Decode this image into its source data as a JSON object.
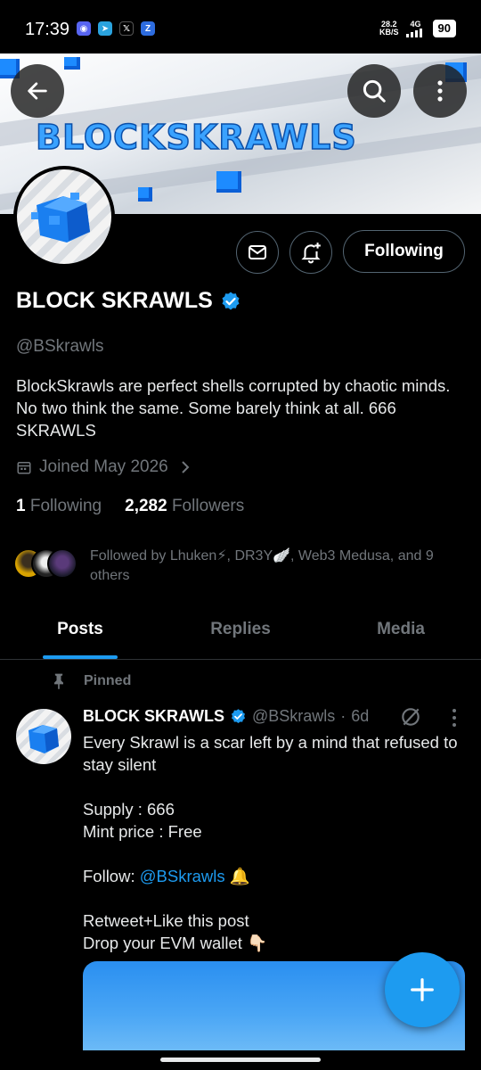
{
  "status_bar": {
    "time": "17:39",
    "net_speed_value": "28.2",
    "net_speed_unit": "KB/S",
    "network": "4G",
    "battery": "90"
  },
  "banner": {
    "title": "BLOCKSKRAWLS"
  },
  "profile": {
    "display_name": "BLOCK SKRAWLS",
    "handle": "@BSkrawls",
    "bio": "BlockSkrawls are perfect shells corrupted by chaotic minds. No two think the same. Some barely think at all. 666 SKRAWLS",
    "joined": "Joined May 2026",
    "following_count": "1",
    "following_label": "Following",
    "followers_count": "2,282",
    "followers_label": "Followers",
    "follow_button_label": "Following",
    "followed_by": "Followed by Lhuken⚡, DR3Y🪽, Web3 Medusa, and 9 others"
  },
  "tabs": [
    {
      "label": "Posts",
      "active": true
    },
    {
      "label": "Replies",
      "active": false
    },
    {
      "label": "Media",
      "active": false
    }
  ],
  "pinned_post": {
    "pinned_label": "Pinned",
    "author_name": "BLOCK SKRAWLS",
    "author_handle": "@BSkrawls",
    "separator": "·",
    "time_ago": "6d",
    "text_1": "Every Skrawl is a scar left by a mind that refused to stay silent",
    "text_2": "Supply : 666",
    "text_3": "Mint price : Free",
    "follow_prefix": "Follow: ",
    "follow_mention": "@BSkrawls",
    "follow_suffix": " 🔔",
    "text_4": "Retweet+Like this post",
    "text_5": "Drop your EVM wallet 👇🏻"
  },
  "colors": {
    "accent": "#1d9bf0",
    "muted": "#71767b",
    "background": "#000000"
  },
  "icons": {
    "back": "back-arrow-icon",
    "search": "search-icon",
    "more": "more-vertical-icon",
    "message": "envelope-icon",
    "notify": "bell-plus-icon",
    "calendar": "calendar-icon",
    "pin": "pin-icon",
    "grok": "grok-icon",
    "compose": "plus-icon"
  }
}
